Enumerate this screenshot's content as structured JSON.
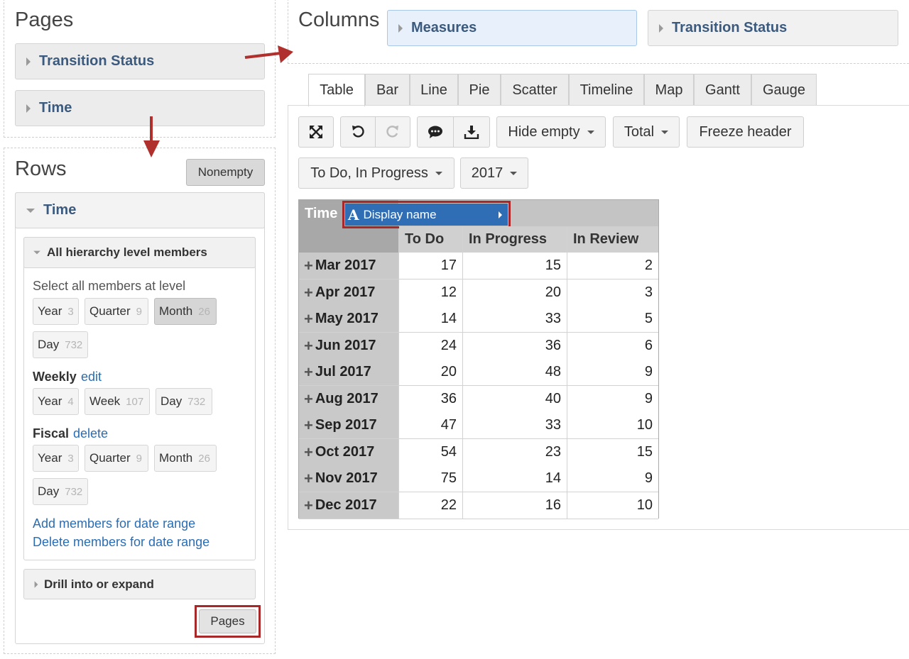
{
  "pages": {
    "title": "Pages",
    "items": [
      "Transition Status",
      "Time"
    ]
  },
  "rows": {
    "title": "Rows",
    "nonempty_label": "Nonempty",
    "time_label": "Time",
    "hierarchy_header": "All hierarchy level members",
    "select_all_label": "Select all members at level",
    "default_levels": [
      {
        "name": "Year",
        "count": "3"
      },
      {
        "name": "Quarter",
        "count": "9"
      },
      {
        "name": "Month",
        "count": "26"
      },
      {
        "name": "Day",
        "count": "732"
      }
    ],
    "weekly_label": "Weekly",
    "weekly_link": "edit",
    "weekly_levels": [
      {
        "name": "Year",
        "count": "4"
      },
      {
        "name": "Week",
        "count": "107"
      },
      {
        "name": "Day",
        "count": "732"
      }
    ],
    "fiscal_label": "Fiscal",
    "fiscal_link": "delete",
    "fiscal_levels": [
      {
        "name": "Year",
        "count": "3"
      },
      {
        "name": "Quarter",
        "count": "9"
      },
      {
        "name": "Month",
        "count": "26"
      },
      {
        "name": "Day",
        "count": "732"
      }
    ],
    "add_range_link": "Add members for date range",
    "delete_range_link": "Delete members for date range",
    "drill_label": "Drill into or expand",
    "pages_button": "Pages"
  },
  "columns": {
    "title": "Columns",
    "items": [
      "Measures",
      "Transition Status"
    ]
  },
  "tabs": [
    "Table",
    "Bar",
    "Line",
    "Pie",
    "Scatter",
    "Timeline",
    "Map",
    "Gantt",
    "Gauge"
  ],
  "toolbar": {
    "hide_empty": "Hide empty",
    "total": "Total",
    "freeze_header": "Freeze header",
    "filter_status": "To Do, In Progress",
    "filter_year": "2017"
  },
  "table": {
    "corner_label": "Time",
    "popup_label": "Display name",
    "popup_glyph": "A",
    "columns": [
      "To Do",
      "In Progress",
      "In Review"
    ],
    "rows": [
      {
        "label": "Mar 2017",
        "values": [
          "17",
          "15",
          "2"
        ]
      },
      {
        "label": "Apr 2017",
        "values": [
          "12",
          "20",
          "3"
        ]
      },
      {
        "label": "May 2017",
        "values": [
          "14",
          "33",
          "5"
        ]
      },
      {
        "label": "Jun 2017",
        "values": [
          "24",
          "36",
          "6"
        ]
      },
      {
        "label": "Jul 2017",
        "values": [
          "20",
          "48",
          "9"
        ]
      },
      {
        "label": "Aug 2017",
        "values": [
          "36",
          "40",
          "9"
        ]
      },
      {
        "label": "Sep 2017",
        "values": [
          "47",
          "33",
          "10"
        ]
      },
      {
        "label": "Oct 2017",
        "values": [
          "54",
          "23",
          "15"
        ]
      },
      {
        "label": "Nov 2017",
        "values": [
          "75",
          "14",
          "9"
        ]
      },
      {
        "label": "Dec 2017",
        "values": [
          "22",
          "16",
          "10"
        ]
      }
    ]
  },
  "colors": {
    "accent": "#3b5a7e",
    "highlight": "#a8282a",
    "popup": "#2f6db5"
  }
}
